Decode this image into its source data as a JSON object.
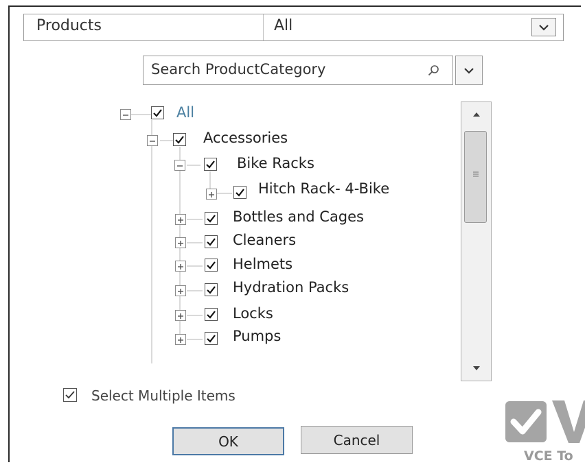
{
  "slicer": {
    "title": "Products",
    "value": "All"
  },
  "search": {
    "placeholder": "Search ProductCategory"
  },
  "tree": {
    "items": [
      {
        "label": "All",
        "checked": true,
        "expanded": true
      },
      {
        "label": "Accessories",
        "checked": true,
        "expanded": true
      },
      {
        "label": "Bike Racks",
        "checked": true,
        "expanded": true
      },
      {
        "label": "Hitch Rack- 4-Bike",
        "checked": true,
        "expanded": false
      },
      {
        "label": "Bottles and Cages",
        "checked": true,
        "expanded": false
      },
      {
        "label": "Cleaners",
        "checked": true,
        "expanded": false
      },
      {
        "label": "Helmets",
        "checked": true,
        "expanded": false
      },
      {
        "label": "Hydration Packs",
        "checked": true,
        "expanded": false
      },
      {
        "label": "Locks",
        "checked": true,
        "expanded": false
      },
      {
        "label": "Pumps",
        "checked": true,
        "expanded": false
      }
    ]
  },
  "options": {
    "select_multiple_label": "Select Multiple Items",
    "select_multiple_checked": true
  },
  "buttons": {
    "ok": "OK",
    "cancel": "Cancel"
  },
  "watermark": {
    "text": "VCE To"
  },
  "colors": {
    "accent": "#4c79a6",
    "root_label": "#4a7fa0"
  },
  "icons": {
    "search": "search-icon",
    "dropdown": "chevron-down-icon",
    "check": "checkmark-icon",
    "expand": "plus-box-icon",
    "collapse": "minus-box-icon"
  }
}
